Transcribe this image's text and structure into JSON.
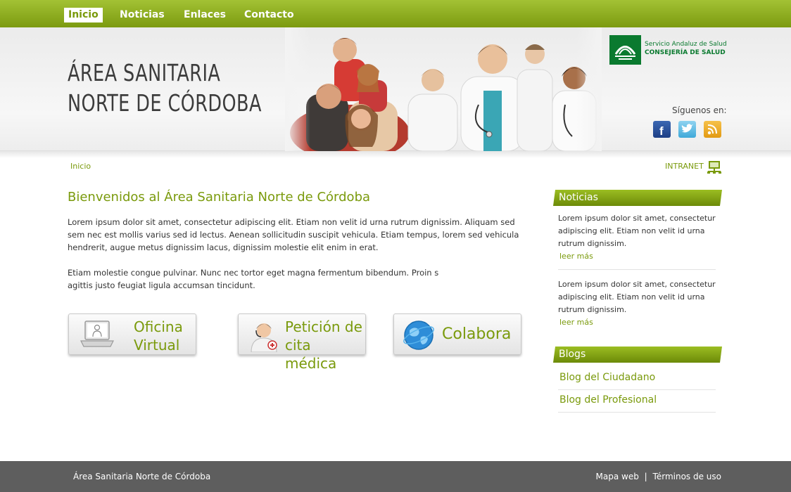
{
  "nav": {
    "items": [
      "Inicio",
      "Noticias",
      "Enlaces",
      "Contacto"
    ]
  },
  "header": {
    "title_line1": "ÁREA SANITARIA",
    "title_line2": "NORTE DE CÓRDOBA",
    "logo_line1": "Servicio Andaluz de Salud",
    "logo_line2": "CONSEJERÍA DE SALUD",
    "follow_label": "Síguenos en:",
    "social": [
      "facebook-icon",
      "twitter-icon",
      "rss-icon"
    ]
  },
  "breadcrumb": "Inicio",
  "intranet_label": "INTRANET",
  "main": {
    "title": "Bienvenidos al Área Sanitaria Norte de Córdoba",
    "para1": "Lorem ipsum dolor sit amet, consectetur adipiscing elit. Etiam non velit id urna rutrum dignissim. Aliquam sed sem nec est mollis varius sed id lectus. Aenean sollicitudin suscipit vehicula. Etiam tempus, lorem sed vehicula hendrerit, augue metus dignissim lacus, dignissim molestie elit enim in erat.",
    "para2_line1": "Etiam molestie congue pulvinar. Nunc nec tortor eget magna fermentum bibendum. Proin s",
    "para2_line2": "agittis justo feugiat ligula accumsan tincidunt.",
    "buttons": [
      {
        "line1": "Oficina",
        "line2": "Virtual"
      },
      {
        "line1": "Petición de",
        "line2": "cita médica"
      },
      {
        "line1": "Colabora"
      }
    ]
  },
  "sidebar": {
    "news_title": "Noticias",
    "news": [
      {
        "text": "Lorem ipsum dolor sit amet, consectetur adipiscing elit. Etiam non velit id urna rutrum dignissim.",
        "more": "leer más"
      },
      {
        "text": "Lorem ipsum dolor sit amet, consectetur adipiscing elit. Etiam non velit id urna rutrum dignissim.",
        "more": "leer más"
      }
    ],
    "blogs_title": "Blogs",
    "blogs": [
      "Blog del Ciudadano",
      "Blog del Profesional"
    ]
  },
  "footer": {
    "left": "Área Sanitaria Norte de Córdoba",
    "link1": "Mapa web",
    "separator": "|",
    "link2": "Términos de uso"
  },
  "colors": {
    "accent": "#7a9a0c",
    "nav_bar": "#8fae1e",
    "footer": "#5e5e5e",
    "brand_green": "#0a7a2f"
  }
}
